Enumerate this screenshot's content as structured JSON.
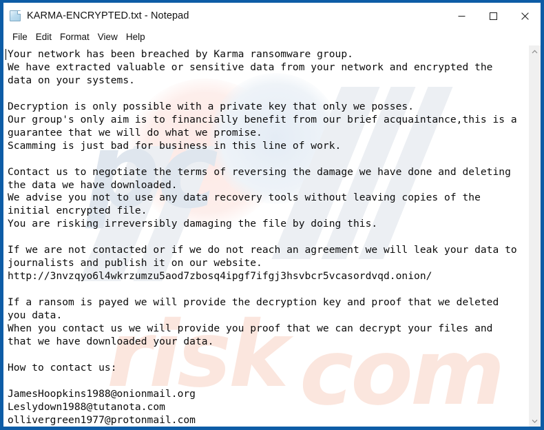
{
  "window": {
    "title": "KARMA-ENCRYPTED.txt - Notepad",
    "icon": "text-file-icon",
    "border_color": "#0d5ca6",
    "controls": {
      "minimize": "Minimize",
      "maximize": "Maximize",
      "close": "Close"
    }
  },
  "menubar": {
    "items": [
      {
        "label": "File"
      },
      {
        "label": "Edit"
      },
      {
        "label": "Format"
      },
      {
        "label": "View"
      },
      {
        "label": "Help"
      }
    ]
  },
  "editor": {
    "content": "Your network has been breached by Karma ransomware group.\nWe have extracted valuable or sensitive data from your network and encrypted the\ndata on your systems.\n\nDecryption is only possible with a private key that only we posses.\nOur group's only aim is to financially benefit from our brief acquaintance,this is a\nguarantee that we will do what we promise.\nScamming is just bad for business in this line of work.\n\nContact us to negotiate the terms of reversing the damage we have done and deleting\nthe data we have downloaded.\nWe advise you not to use any data recovery tools without leaving copies of the\ninitial encrypted file.\nYou are risking irreversibly damaging the file by doing this.\n\nIf we are not contacted or if we do not reach an agreement we will leak your data to\njournalists and publish it on our website.\nhttp://3nvzqyo6l4wkrzumzu5aod7zbosq4ipgf7ifgj3hsvbcr5vcasordvqd.onion/\n\nIf a ransom is payed we will provide the decryption key and proof that we deleted\nyou data.\nWhen you contact us we will provide you proof that we can decrypt your files and\nthat we have downloaded your data.\n\nHow to contact us:\n\nJamesHoopkins1988@onionmail.org\nLeslydown1988@tutanota.com\nollivergreen1977@protonmail.com",
    "onion_url": "http://3nvzqyo6l4wkrzumzu5aod7zbosq4ipgf7ifgj3hsvbcr5vcasordvqd.onion/",
    "emails": [
      "JamesHoopkins1988@onionmail.org",
      "Leslydown1988@tutanota.com",
      "ollivergreen1977@protonmail.com"
    ]
  },
  "watermark": {
    "part1": "pc",
    "part2": "risk",
    "part3": "com"
  },
  "scrollbar": {
    "up_arrow": "scroll-up",
    "down_arrow": "scroll-down"
  }
}
